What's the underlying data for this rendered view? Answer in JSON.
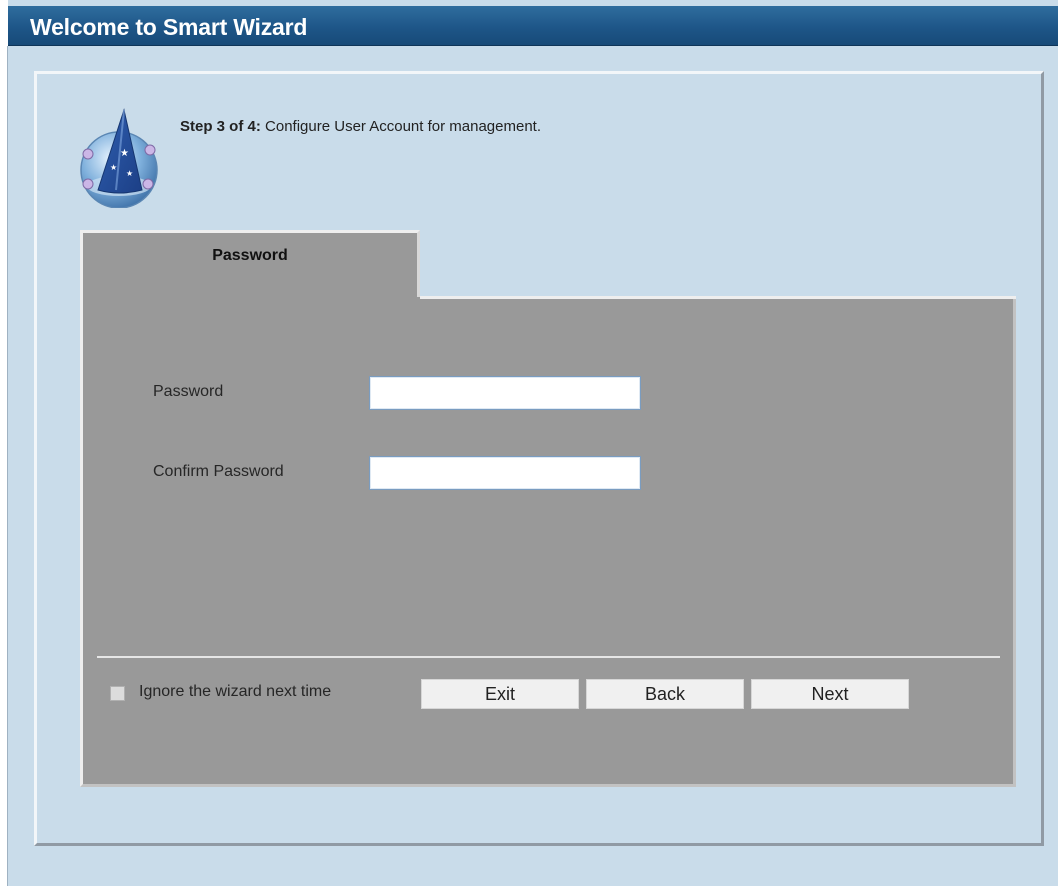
{
  "window": {
    "title": "Welcome to Smart Wizard"
  },
  "wizard": {
    "step_prefix": "Step 3 of 4:",
    "step_text": " Configure User Account for management.",
    "icon": "wizard-hat-icon"
  },
  "tabs": [
    {
      "label": "Password",
      "selected": true
    }
  ],
  "form": {
    "password": {
      "label": "Password",
      "value": ""
    },
    "confirm_password": {
      "label": "Confirm Password",
      "value": ""
    }
  },
  "footer": {
    "ignore_checkbox": {
      "label": "Ignore the wizard next time",
      "checked": false
    },
    "buttons": {
      "exit": "Exit",
      "back": "Back",
      "next": "Next"
    }
  },
  "colors": {
    "title_bar": "#1e5688",
    "page_background": "#c9dcea",
    "panel": "#999999"
  }
}
